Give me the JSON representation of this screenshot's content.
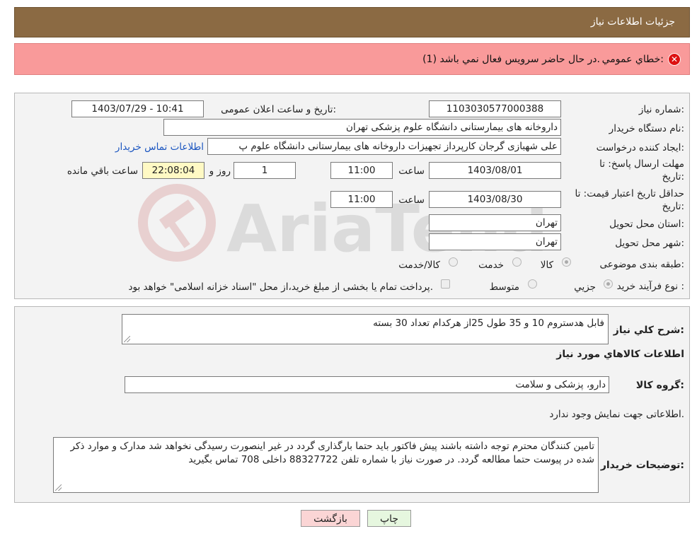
{
  "header": {
    "title": "جزئیات اطلاعات نیاز"
  },
  "error": {
    "label": "خطاي عمومي:",
    "message": "در حال حاضر سرويس فعال نمي باشد (1)."
  },
  "form": {
    "need_number": {
      "label": "شماره نیاز:",
      "value": "1103030577000388"
    },
    "announce_datetime": {
      "label": "تاریخ و ساعت اعلان عمومی:",
      "value": "1403/07/29 - 10:41"
    },
    "buyer_org": {
      "label": "نام دستگاه خریدار:",
      "value": "داروخانه های بیمارستانی دانشگاه علوم پزشکی تهران"
    },
    "requester": {
      "label": "ایجاد کننده درخواست:",
      "value": "علی شهبازی گرجان کارپرداز تجهیزات داروخانه های بیمارستانی دانشگاه علوم پ",
      "contact_link": "اطلاعات تماس خریدار"
    },
    "response_deadline": {
      "label_line1": "مهلت ارسال پاسخ: تا",
      "label_line2": "تاریخ:",
      "date": "1403/08/01",
      "time_label": "ساعت",
      "time": "11:00",
      "days": "1",
      "days_label": "روز و",
      "remaining": "22:08:04",
      "remaining_label": "ساعت باقي مانده"
    },
    "price_validity": {
      "label_line1": "حداقل تاریخ اعتبار قیمت: تا",
      "label_line2": "تاریخ:",
      "date": "1403/08/30",
      "time_label": "ساعت",
      "time": "11:00"
    },
    "delivery_province": {
      "label": "استان محل تحویل:",
      "value": "تهران"
    },
    "delivery_city": {
      "label": "شهر محل تحویل:",
      "value": "تهران"
    },
    "category": {
      "label": "طبقه بندی موضوعی:",
      "options": [
        "کالا",
        "خدمت",
        "کالا/خدمت"
      ],
      "selected": "کالا"
    },
    "purchase_process": {
      "label": "نوع فرآیند خرید :",
      "options": [
        "جزیي",
        "متوسط"
      ],
      "selected": "جزیي",
      "payment_note": "پرداخت تمام یا بخشی از مبلغ خرید،از محل \"اسناد خزانه اسلامی\" خواهد بود."
    }
  },
  "details": {
    "summary_label": "شرح کلي نیاز:",
    "summary_value": "فابل هدستروم 10  و 35 طول 25از هرکدام تعداد 30 بسته",
    "goods_info_title": "اطلاعات کالاهاي مورد نیاز",
    "goods_group_label": "گروه کالا:",
    "goods_group_value": "دارو، پزشکی و سلامت",
    "no_info_text": "اطلاعاتی جهت نمایش وجود ندارد.",
    "buyer_notes_label": "توضیحات خریدار:",
    "buyer_notes_value": "تامین کنندگان محترم توجه داشته باشند پیش فاکتور باید حتما بارگذاری گردد در غیر اینصورت رسیدگی نخواهد شد مدارک و موارد ذکر شده در پیوست حتما مطالعه گردد. در صورت نیاز با شماره تلفن 88327722 داخلی 708 تماس بگیرید"
  },
  "buttons": {
    "print": "چاپ",
    "back": "بازگشت"
  },
  "watermark": {
    "text": "AriaTender.neT"
  },
  "colors": {
    "header": "#8b6a43",
    "error_bg": "#f99a9a",
    "link": "#1a55c0",
    "timer_bg": "#fff9c4",
    "back_btn": "#fbd5d5",
    "print_btn": "#e6f7df"
  }
}
